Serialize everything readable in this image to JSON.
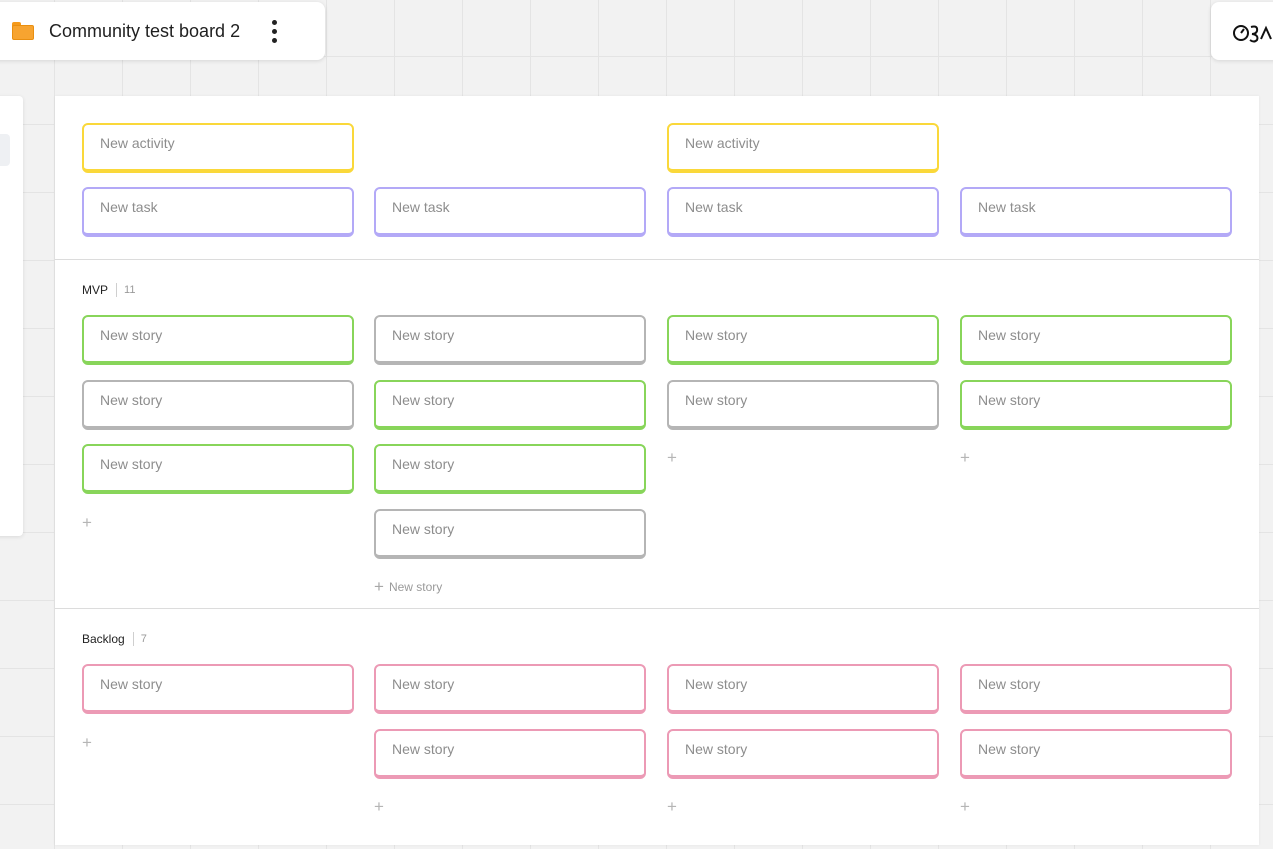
{
  "header": {
    "board_title": "Community test board 2",
    "folder_icon": "folder-icon",
    "menu_icon": "more-vertical-icon",
    "folder_color": "#f7a430"
  },
  "colors": {
    "activity": "#fad83a",
    "task": "#b3a9f7",
    "story_green": "#88d55a",
    "story_grey": "#b5b5b5",
    "story_pink": "#ec9ab5"
  },
  "backbone": {
    "activities": [
      {
        "label": "New activity",
        "column": 1
      },
      {
        "label": "New activity",
        "column": 3
      }
    ],
    "tasks": [
      {
        "label": "New task",
        "column": 1
      },
      {
        "label": "New task",
        "column": 2
      },
      {
        "label": "New task",
        "column": 3
      },
      {
        "label": "New task",
        "column": 4
      }
    ]
  },
  "releases": [
    {
      "name": "MVP",
      "count": "11",
      "columns": [
        {
          "stories": [
            {
              "label": "New story",
              "status": "green"
            },
            {
              "label": "New story",
              "status": "grey"
            },
            {
              "label": "New story",
              "status": "green"
            }
          ]
        },
        {
          "stories": [
            {
              "label": "New story",
              "status": "grey"
            },
            {
              "label": "New story",
              "status": "green"
            },
            {
              "label": "New story",
              "status": "green"
            },
            {
              "label": "New story",
              "status": "grey"
            }
          ],
          "add_label": "New story"
        },
        {
          "stories": [
            {
              "label": "New story",
              "status": "green"
            },
            {
              "label": "New story",
              "status": "grey"
            }
          ]
        },
        {
          "stories": [
            {
              "label": "New story",
              "status": "green"
            },
            {
              "label": "New story",
              "status": "green"
            }
          ]
        }
      ]
    },
    {
      "name": "Backlog",
      "count": "7",
      "columns": [
        {
          "stories": [
            {
              "label": "New story",
              "status": "pink"
            }
          ]
        },
        {
          "stories": [
            {
              "label": "New story",
              "status": "pink"
            },
            {
              "label": "New story",
              "status": "pink"
            }
          ]
        },
        {
          "stories": [
            {
              "label": "New story",
              "status": "pink"
            },
            {
              "label": "New story",
              "status": "pink"
            }
          ]
        },
        {
          "stories": [
            {
              "label": "New story",
              "status": "pink"
            },
            {
              "label": "New story",
              "status": "pink"
            }
          ]
        }
      ]
    }
  ]
}
